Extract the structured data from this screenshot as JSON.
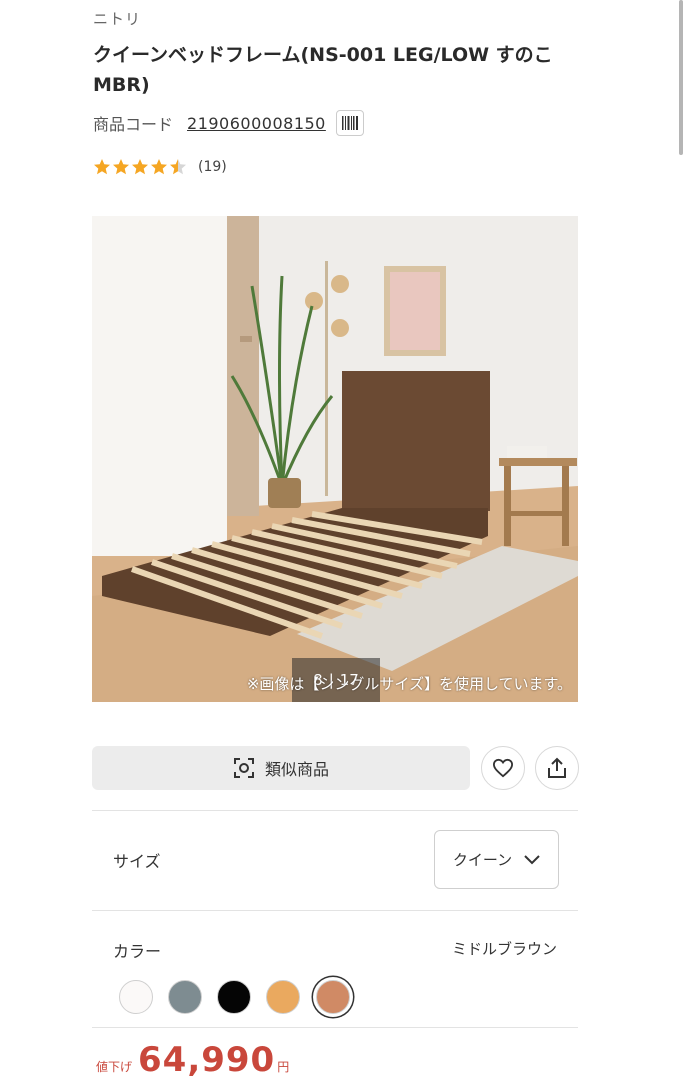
{
  "brand": "ニトリ",
  "product": {
    "title": "クイーンベッドフレーム(NS-001 LEG/LOW すのこ MBR)",
    "code_label": "商品コード",
    "code_value": "2190600008150",
    "barcode_icon": "barcode-icon",
    "rating": {
      "value": 4.5,
      "max": 5,
      "count": "(19)"
    }
  },
  "image": {
    "caption": "※画像は【シングルサイズ】を使用しています。",
    "pager": {
      "current": "8",
      "total": "17"
    }
  },
  "actions": {
    "similar_label": "類似商品",
    "similar_icon": "camera-scan-icon",
    "favorite_icon": "heart-icon",
    "share_icon": "share-icon"
  },
  "options": {
    "size_label": "サイズ",
    "size_value": "クイーン",
    "color_label": "カラー",
    "color_value": "ミドルブラウン",
    "swatches": [
      {
        "name": "white",
        "color": "#fbf9f8"
      },
      {
        "name": "gray",
        "color": "#7e8c91"
      },
      {
        "name": "black",
        "color": "#050505"
      },
      {
        "name": "light-brown",
        "color": "#eaa95f"
      },
      {
        "name": "middle-brown",
        "color": "#d08a65",
        "selected": true
      }
    ]
  },
  "price": {
    "badge": "値下げ",
    "value": "64,990",
    "unit": "円",
    "color": "#c9473b"
  }
}
